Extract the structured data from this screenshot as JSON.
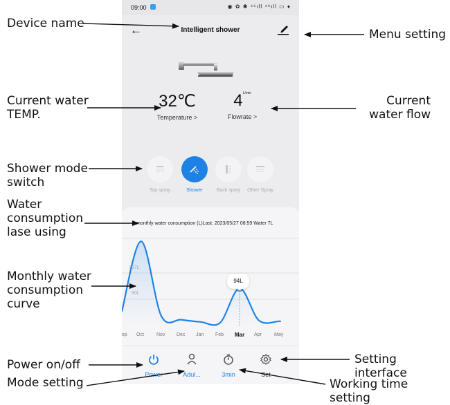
{
  "annotations": {
    "device_name": "Device name",
    "menu_setting": "Menu setting",
    "current_temp": "Current water\nTEMP.",
    "current_flow": "Current\nwater flow",
    "shower_mode": "Shower mode\nswitch",
    "water_consumption": "Water\nconsumption\nlase using",
    "monthly_curve": "Monthly water\nconsumption\ncurve",
    "power": "Power on/off",
    "mode_setting": "Mode setting",
    "setting_interface": "Setting interface",
    "working_time": "Working time setting"
  },
  "status_bar": {
    "time": "09:00",
    "icons": "◉ ✿ ✱ ⁴⁶ıll ⁴⁶ıll ▭ ♦"
  },
  "header": {
    "title": "Intelligent shower"
  },
  "readouts": {
    "temperature": {
      "value": "32℃",
      "label": "Temperature >"
    },
    "flowrate": {
      "value": "4",
      "unit": "L/min",
      "label": "Flowrate >"
    }
  },
  "modes": [
    {
      "label": "Top spray",
      "icon": "top-spray-icon",
      "active": false
    },
    {
      "label": "Shower",
      "icon": "shower-icon",
      "active": true
    },
    {
      "label": "Back spray",
      "icon": "back-spray-icon",
      "active": false
    },
    {
      "label": "Other Spray",
      "icon": "other-spray-icon",
      "active": false
    }
  ],
  "consumption": {
    "info": "monthly water consumption (L)Last: 2023/05/27 08:59 Water 7L",
    "tooltip": "94L"
  },
  "chart_data": {
    "type": "line",
    "categories": [
      "Sep",
      "Oct",
      "Nov",
      "Dec",
      "Jan",
      "Feb",
      "Mar",
      "Apr",
      "May"
    ],
    "tick_labels": [
      "ep",
      "Oct",
      "Nov",
      "Dec",
      "Jan",
      "Feb",
      "Mar",
      "Apr",
      "May"
    ],
    "values": [
      40,
      220,
      20,
      10,
      4,
      2,
      94,
      8,
      6
    ],
    "y_labels": [
      "137L",
      "90L"
    ],
    "selected": "Mar",
    "color": "#1e82e5"
  },
  "bottom_bar": [
    {
      "label": "Power",
      "icon": "power-icon",
      "highlight": true
    },
    {
      "label": "Adul...",
      "icon": "person-icon",
      "highlight": true
    },
    {
      "label": "3min",
      "icon": "timer-icon",
      "highlight": true
    },
    {
      "label": "Set",
      "icon": "gear-icon",
      "highlight": false
    }
  ]
}
